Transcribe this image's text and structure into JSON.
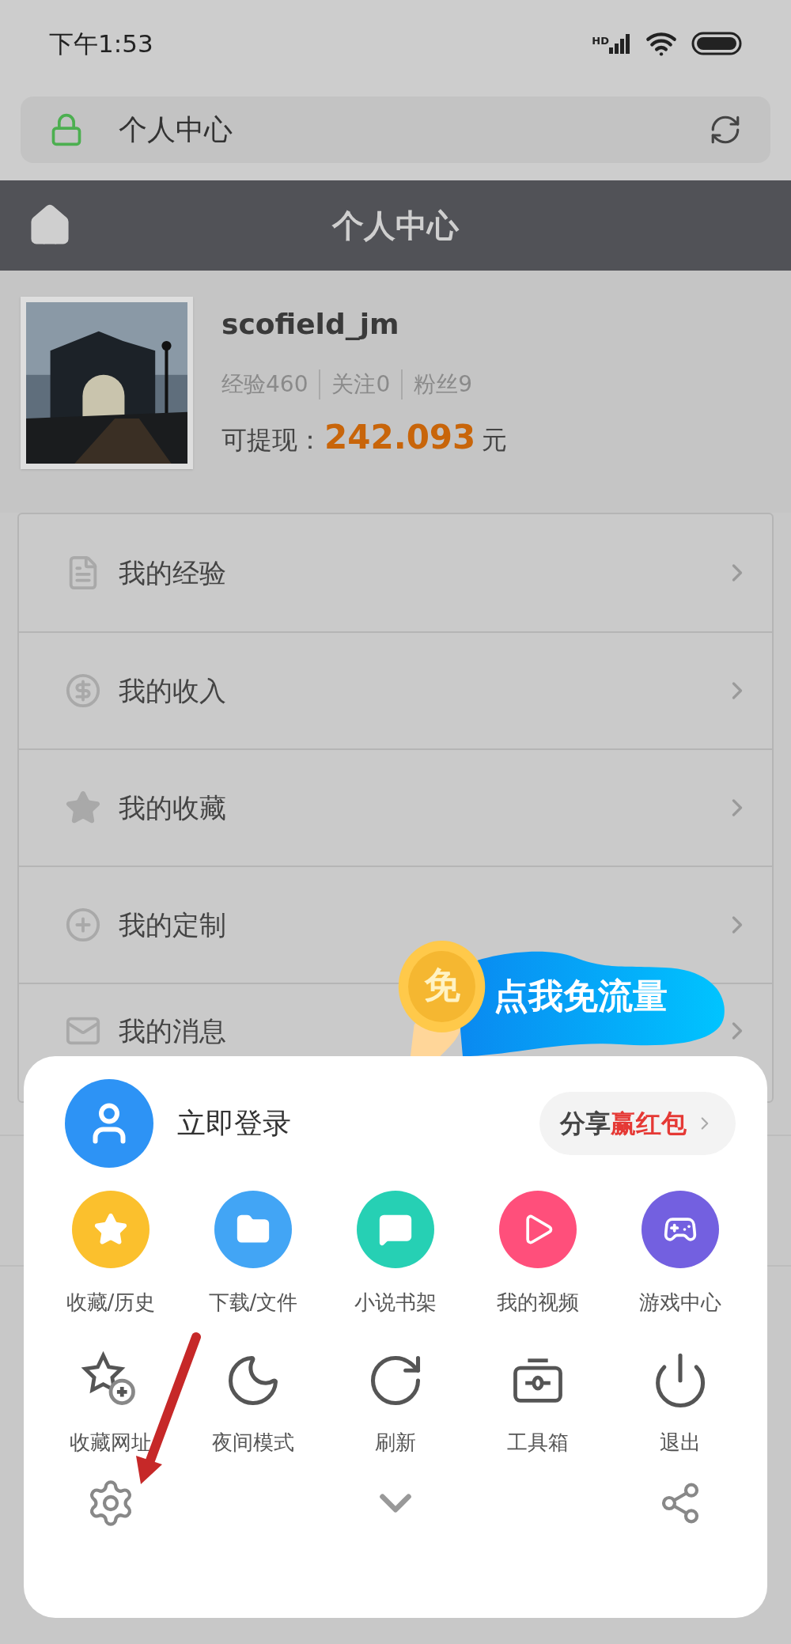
{
  "status_bar": {
    "time": "下午1:53",
    "network": "HD"
  },
  "address_bar": {
    "title": "个人中心"
  },
  "header": {
    "title": "个人中心"
  },
  "profile": {
    "username": "scofield_jm",
    "stats": [
      "经验460",
      "关注0",
      "粉丝9"
    ],
    "balance_label": "可提现：",
    "balance": "242.093",
    "currency": "元"
  },
  "menu": [
    {
      "kind": "document",
      "label": "我的经验"
    },
    {
      "kind": "dollar",
      "label": "我的收入"
    },
    {
      "kind": "star",
      "label": "我的收藏"
    },
    {
      "kind": "plus",
      "label": "我的定制"
    },
    {
      "kind": "mail",
      "label": "我的消息"
    }
  ],
  "ad_banner": {
    "coin_text": "免",
    "text": "点我免流量"
  },
  "sheet": {
    "login": "立即登录",
    "share": {
      "label": "分享",
      "highlight": "赢红包"
    },
    "apps": [
      {
        "kind": "star",
        "label": "收藏/历史",
        "color": "#fbc02d"
      },
      {
        "kind": "folder",
        "label": "下载/文件",
        "color": "#42a5f5"
      },
      {
        "kind": "book",
        "label": "小说书架",
        "color": "#26d0b4"
      },
      {
        "kind": "video",
        "label": "我的视频",
        "color": "#ff4f7b"
      },
      {
        "kind": "game",
        "label": "游戏中心",
        "color": "#7360e0"
      }
    ],
    "tools": [
      {
        "kind": "starplus",
        "label": "收藏网址"
      },
      {
        "kind": "moon",
        "label": "夜间模式"
      },
      {
        "kind": "refresh",
        "label": "刷新"
      },
      {
        "kind": "toolbox",
        "label": "工具箱"
      },
      {
        "kind": "power",
        "label": "退出"
      }
    ]
  }
}
